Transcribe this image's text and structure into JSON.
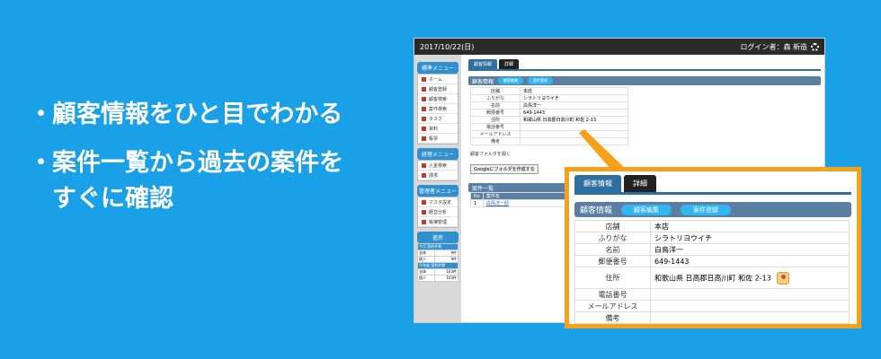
{
  "bullets": [
    {
      "marker": "・",
      "lines": [
        "顧客情報をひと目でわかる"
      ]
    },
    {
      "marker": "・",
      "lines": [
        "案件一覧から過去の案件を",
        "すぐに確認"
      ]
    }
  ],
  "app": {
    "date": "2017/10/22(日)",
    "login_label": "ログイン者：森 新造",
    "sidebar": {
      "standard_menu": "標準メニュー",
      "standard_items": [
        "ホーム",
        "顧客登録",
        "顧客検索",
        "案件検索",
        "タスク",
        "資料",
        "帳票"
      ],
      "manage_menu": "経理メニュー",
      "manage_items": [
        "入金検索",
        "請求"
      ],
      "admin_menu": "管理者メニュー",
      "admin_items": [
        "マスタ設定",
        "経営分析",
        "帳簿管理"
      ],
      "progress": {
        "title": "進捗",
        "rows": [
          {
            "label": "今月 契約件数",
            "value": "",
            "header": true
          },
          {
            "label": "全体",
            "value": "9件"
          },
          {
            "label": "個人",
            "value": "9件"
          },
          {
            "label": "今年度 契約件数",
            "value": "",
            "header": true
          },
          {
            "label": "全体",
            "value": "103件"
          },
          {
            "label": "個人",
            "value": "103件"
          }
        ]
      }
    },
    "tabs": [
      "顧客情報",
      "詳細"
    ],
    "section_title": "顧客情報",
    "section_buttons": [
      "顧客編集",
      "案件登録"
    ],
    "customer_fields": [
      {
        "label": "店舗",
        "value": "本店"
      },
      {
        "label": "ふりがな",
        "value": "シラトリヨウイチ"
      },
      {
        "label": "名前",
        "value": "白鳥洋一"
      },
      {
        "label": "郵便番号",
        "value": "649-1443"
      },
      {
        "label": "住所",
        "value": "和歌山県 日高郡日高川町 和佐 2-13"
      },
      {
        "label": "電話番号",
        "value": ""
      },
      {
        "label": "メールアドレス",
        "value": ""
      },
      {
        "label": "備考",
        "value": ""
      }
    ],
    "folder_link": "顧客フォルダを開く",
    "google_button": "Googleにフォルダを作成する",
    "case_list": {
      "title": "案件一覧",
      "headers": [
        "No",
        "案件名"
      ],
      "rows": [
        [
          "1",
          "白鳥洋一邸"
        ]
      ]
    }
  },
  "colors": {
    "background": "#1aa0e6",
    "callout_border": "#f7a11a",
    "section_header": "#5b7fa3"
  }
}
